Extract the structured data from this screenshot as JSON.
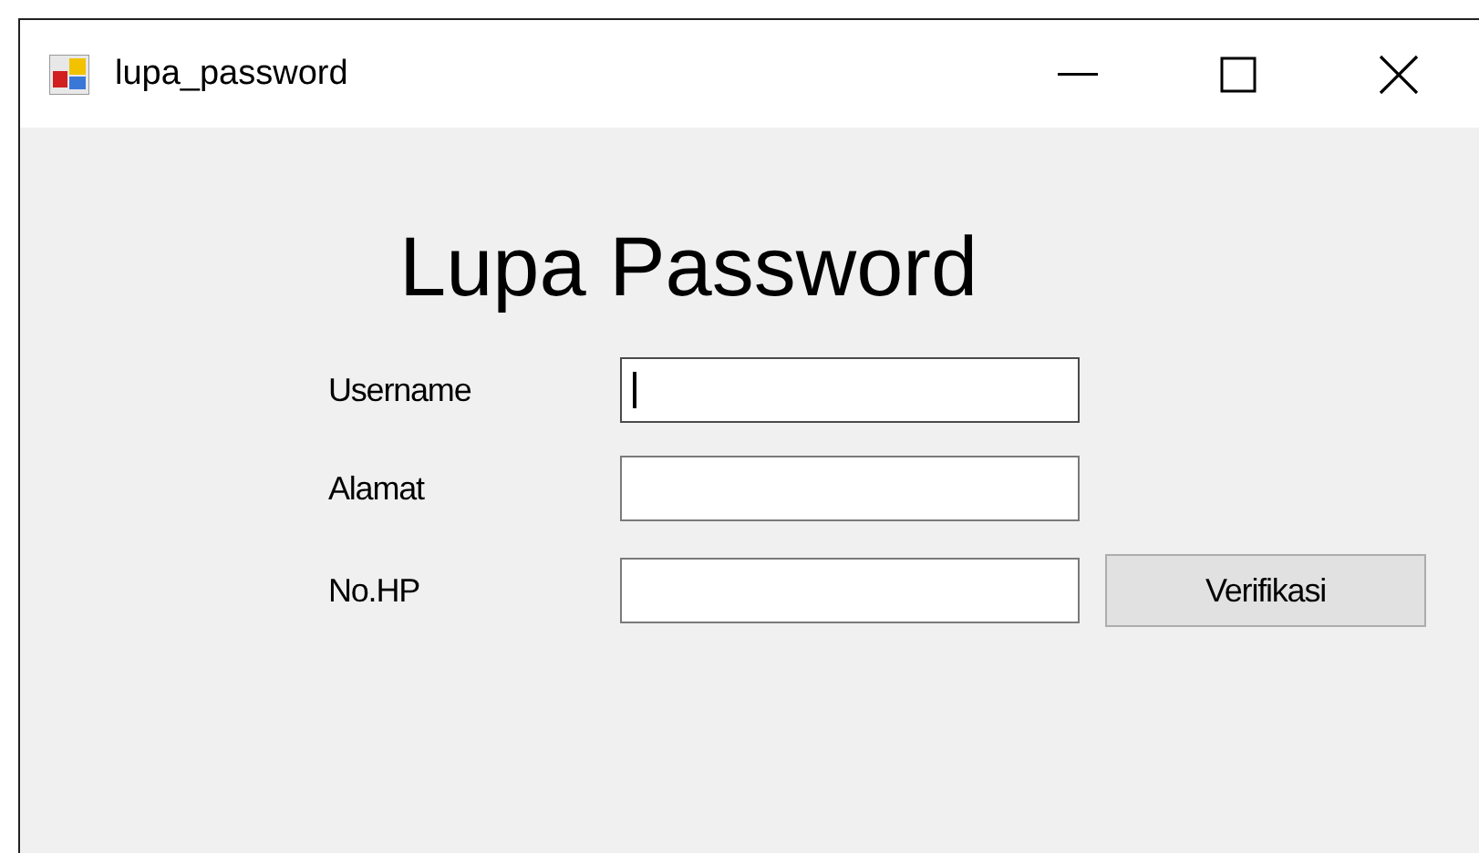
{
  "window": {
    "title": "lupa_password"
  },
  "heading": "Lupa Password",
  "fields": [
    {
      "label": "Username",
      "focused": true
    },
    {
      "label": "Alamat",
      "focused": false
    },
    {
      "label": "No.HP",
      "focused": false
    }
  ],
  "verify_button": {
    "label": "Verifikasi"
  }
}
